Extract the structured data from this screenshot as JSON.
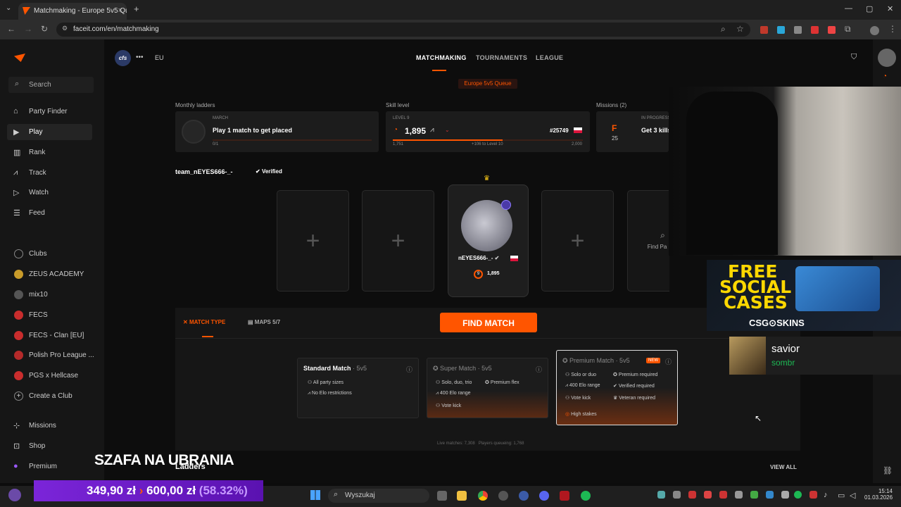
{
  "browser": {
    "tab_title": "Matchmaking - Europe 5v5 Qu",
    "url": "faceit.com/en/matchmaking"
  },
  "sidebar": {
    "search": "Search",
    "items": [
      {
        "label": "Party Finder",
        "icon": "party-icon"
      },
      {
        "label": "Play",
        "icon": "play-icon",
        "active": true
      },
      {
        "label": "Rank",
        "icon": "rank-icon"
      },
      {
        "label": "Track",
        "icon": "track-icon"
      },
      {
        "label": "Watch",
        "icon": "watch-icon"
      },
      {
        "label": "Feed",
        "icon": "feed-icon"
      }
    ],
    "clubs": [
      {
        "label": "Clubs",
        "color": "#666666"
      },
      {
        "label": "ZEUS ACADEMY",
        "color": "#c89b2a"
      },
      {
        "label": "mix10",
        "color": "#555555"
      },
      {
        "label": "FECS",
        "color": "#c92d2d"
      },
      {
        "label": "FECS - Clan [EU]",
        "color": "#c92d2d"
      },
      {
        "label": "Polish Pro League ...",
        "color": "#b52a2a"
      },
      {
        "label": "PGS x Hellcase",
        "color": "#c92d2d"
      },
      {
        "label": "Create a Club",
        "color": "#444444"
      }
    ],
    "bottom": [
      {
        "label": "Missions"
      },
      {
        "label": "Shop"
      },
      {
        "label": "Premium"
      }
    ]
  },
  "header": {
    "team_tag": "cfs",
    "region": "EU",
    "tabs": [
      "MATCHMAKING",
      "TOURNAMENTS",
      "LEAGUE"
    ],
    "queue": "Europe 5v5 Queue"
  },
  "ladders": {
    "label": "Monthly ladders",
    "month": "MARCH",
    "title": "Play 1 match to get placed",
    "progress": "0/1"
  },
  "skill": {
    "label": "Skill level",
    "level": "LEVEL 9",
    "elo": "1,895",
    "rank": "#25749",
    "min": "1,751",
    "to_next": "+106 to Level 10",
    "max": "2,000"
  },
  "missions": {
    "label": "Missions (2)",
    "status": "IN PROGRESS",
    "title": "Get 3 kills",
    "count": "25",
    "letter": "F"
  },
  "team": {
    "name": "team_nEYES666-_-",
    "verified": "Verified"
  },
  "party": {
    "player": "nEYES666-_-",
    "elo": "1,895",
    "level": "9",
    "find": "Find Pa"
  },
  "tabs": {
    "match_type": "MATCH TYPE",
    "maps": "MAPS 5/7",
    "find": "FIND MATCH"
  },
  "modes": [
    {
      "name": "Standard Match",
      "size": " · 5v5",
      "features": [
        "All party sizes",
        "No Elo restrictions"
      ]
    },
    {
      "name": "Super Match",
      "size": " · 5v5",
      "features": [
        "Solo, duo, trio",
        "400 Elo range",
        "Vote kick"
      ],
      "extra": [
        "Premium flex"
      ]
    },
    {
      "name": "Premium Match",
      "size": " · 5v5",
      "badge": "NEW",
      "features": [
        "Solo or duo",
        "400 Elo range",
        "Vote kick"
      ],
      "extra": [
        "Premium required",
        "Verified required",
        "Veteran required"
      ],
      "stakes": "High stakes"
    }
  ],
  "stats": {
    "live": "Live matches: 7,308",
    "queue": "Players queueing: 1,768"
  },
  "ladders_footer": {
    "title": "Ladders",
    "view_all": "VIEW ALL"
  },
  "overlay": {
    "ad_line1": "FREE",
    "ad_line2": "SOCIAL",
    "ad_line3": "CASES",
    "ad_brand": "CSG⊙SKINS",
    "song": "savior",
    "artist": "sombr",
    "banner": "SZAFA NA UBRANIA",
    "price_old": "349,90 zł",
    "price_new": "600,00 zł",
    "price_pct": "(58.32%)"
  },
  "taskbar": {
    "search": "Wyszukaj",
    "time": "15:14",
    "date": "01.03.2026"
  }
}
